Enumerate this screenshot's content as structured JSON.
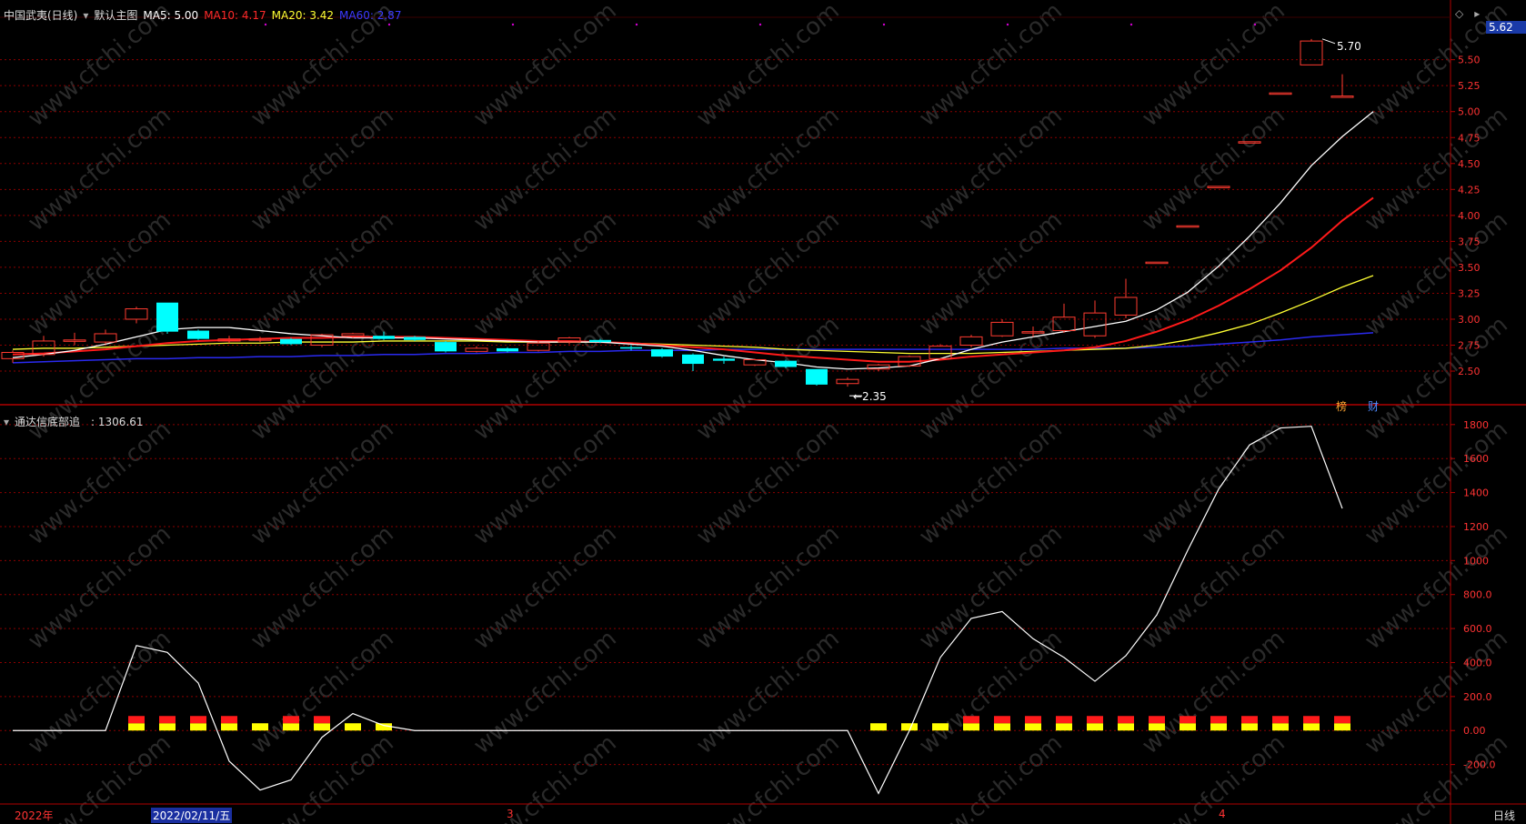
{
  "main_header": {
    "stock_name": "中国武夷(日线)",
    "template": "默认主图",
    "ma5": "MA5: 5.00",
    "ma10": "MA10: 4.17",
    "ma20": "MA20: 3.42",
    "ma60": "MA60: 2.87"
  },
  "indicator_header": {
    "name": "通达信底部追",
    "value": ": 1306.61"
  },
  "price_marks": {
    "high": "5.70",
    "low": "2.35"
  },
  "current_price": "5.62",
  "price_axis_ticks": [
    "5.50",
    "5.25",
    "5.00",
    "4.75",
    "4.50",
    "4.25",
    "4.00",
    "3.75",
    "3.50",
    "3.25",
    "3.00",
    "2.75",
    "2.50"
  ],
  "indicator_axis_ticks": [
    "1800",
    "1600",
    "1400",
    "1200",
    "1000",
    "800.0",
    "600.0",
    "400.0",
    "200.0",
    "0.00",
    "-200.0"
  ],
  "bottom_axis": {
    "year": "2022年",
    "cursor_date": "2022/02/11/五",
    "m3": "3",
    "m4": "4",
    "period": "日线"
  },
  "chart_badges": {
    "bang": "榜",
    "cai": "财"
  },
  "watermark": "www.cfchi.com",
  "colors": {
    "up": "#ff3b30",
    "down": "#00ffff",
    "ma5": "#ffffff",
    "ma10": "#ff1a1a",
    "ma20": "#ffff33",
    "ma60": "#2a2af0",
    "bg": "#000000",
    "grid": "#8b0000"
  },
  "chart_data": [
    {
      "type": "candlestick",
      "y_ticks": [
        2.5,
        2.75,
        3.0,
        3.25,
        3.5,
        3.75,
        4.0,
        4.25,
        4.5,
        4.75,
        5.0,
        5.25,
        5.5
      ],
      "ylim": [
        2.22,
        5.9
      ],
      "candles": [
        {
          "o": 2.62,
          "c": 2.68,
          "h": 2.7,
          "l": 2.58
        },
        {
          "o": 2.66,
          "c": 2.79,
          "h": 2.84,
          "l": 2.64
        },
        {
          "o": 2.79,
          "c": 2.8,
          "h": 2.87,
          "l": 2.75
        },
        {
          "o": 2.78,
          "c": 2.86,
          "h": 2.9,
          "l": 2.76
        },
        {
          "o": 3.0,
          "c": 3.1,
          "h": 3.12,
          "l": 2.96
        },
        {
          "o": 3.16,
          "c": 2.88,
          "h": 3.16,
          "l": 2.86
        },
        {
          "o": 2.89,
          "c": 2.81,
          "h": 2.9,
          "l": 2.8
        },
        {
          "o": 2.79,
          "c": 2.81,
          "h": 2.84,
          "l": 2.77
        },
        {
          "o": 2.81,
          "c": 2.81,
          "h": 2.83,
          "l": 2.78
        },
        {
          "o": 2.81,
          "c": 2.76,
          "h": 2.82,
          "l": 2.75
        },
        {
          "o": 2.75,
          "c": 2.85,
          "h": 2.86,
          "l": 2.73
        },
        {
          "o": 2.84,
          "c": 2.86,
          "h": 2.87,
          "l": 2.82
        },
        {
          "o": 2.84,
          "c": 2.81,
          "h": 2.88,
          "l": 2.8
        },
        {
          "o": 2.83,
          "c": 2.8,
          "h": 2.84,
          "l": 2.79
        },
        {
          "o": 2.78,
          "c": 2.69,
          "h": 2.79,
          "l": 2.68
        },
        {
          "o": 2.69,
          "c": 2.72,
          "h": 2.74,
          "l": 2.68
        },
        {
          "o": 2.72,
          "c": 2.69,
          "h": 2.73,
          "l": 2.68
        },
        {
          "o": 2.7,
          "c": 2.77,
          "h": 2.79,
          "l": 2.69
        },
        {
          "o": 2.78,
          "c": 2.82,
          "h": 2.83,
          "l": 2.76
        },
        {
          "o": 2.8,
          "c": 2.78,
          "h": 2.81,
          "l": 2.77
        },
        {
          "o": 2.73,
          "c": 2.72,
          "h": 2.75,
          "l": 2.7
        },
        {
          "o": 2.71,
          "c": 2.64,
          "h": 2.72,
          "l": 2.63
        },
        {
          "o": 2.66,
          "c": 2.57,
          "h": 2.67,
          "l": 2.5
        },
        {
          "o": 2.62,
          "c": 2.6,
          "h": 2.64,
          "l": 2.57
        },
        {
          "o": 2.56,
          "c": 2.61,
          "h": 2.62,
          "l": 2.55
        },
        {
          "o": 2.6,
          "c": 2.54,
          "h": 2.61,
          "l": 2.53
        },
        {
          "o": 2.52,
          "c": 2.37,
          "h": 2.52,
          "l": 2.36
        },
        {
          "o": 2.38,
          "c": 2.42,
          "h": 2.44,
          "l": 2.35
        },
        {
          "o": 2.52,
          "c": 2.56,
          "h": 2.57,
          "l": 2.5
        },
        {
          "o": 2.55,
          "c": 2.64,
          "h": 2.65,
          "l": 2.54
        },
        {
          "o": 2.62,
          "c": 2.74,
          "h": 2.76,
          "l": 2.61
        },
        {
          "o": 2.75,
          "c": 2.83,
          "h": 2.85,
          "l": 2.73
        },
        {
          "o": 2.84,
          "c": 2.97,
          "h": 3.0,
          "l": 2.83
        },
        {
          "o": 2.88,
          "c": 2.88,
          "h": 2.93,
          "l": 2.83
        },
        {
          "o": 2.89,
          "c": 3.02,
          "h": 3.15,
          "l": 2.87
        },
        {
          "o": 2.84,
          "c": 3.06,
          "h": 3.18,
          "l": 2.82
        },
        {
          "o": 3.04,
          "c": 3.21,
          "h": 3.39,
          "l": 3.01
        },
        {
          "o": 3.55,
          "c": 3.55,
          "h": 3.55,
          "l": 3.55
        },
        {
          "o": 3.9,
          "c": 3.9,
          "h": 3.9,
          "l": 3.9
        },
        {
          "o": 4.28,
          "c": 4.28,
          "h": 4.28,
          "l": 4.28
        },
        {
          "o": 4.71,
          "c": 4.71,
          "h": 4.71,
          "l": 4.71
        },
        {
          "o": 5.18,
          "c": 5.18,
          "h": 5.18,
          "l": 5.18
        },
        {
          "o": 5.45,
          "c": 5.68,
          "h": 5.7,
          "l": 5.45
        },
        {
          "o": 5.15,
          "c": 5.15,
          "h": 5.36,
          "l": 5.15
        }
      ],
      "ma5": [
        2.63,
        2.66,
        2.7,
        2.76,
        2.83,
        2.9,
        2.92,
        2.92,
        2.89,
        2.86,
        2.84,
        2.82,
        2.82,
        2.82,
        2.81,
        2.8,
        2.79,
        2.78,
        2.78,
        2.78,
        2.76,
        2.74,
        2.7,
        2.65,
        2.61,
        2.58,
        2.54,
        2.52,
        2.53,
        2.55,
        2.62,
        2.71,
        2.78,
        2.83,
        2.88,
        2.93,
        2.98,
        3.09,
        3.26,
        3.51,
        3.8,
        4.12,
        4.48,
        4.76,
        5.0
      ],
      "ma10": [
        2.66,
        2.67,
        2.69,
        2.71,
        2.74,
        2.77,
        2.79,
        2.8,
        2.81,
        2.82,
        2.82,
        2.83,
        2.83,
        2.83,
        2.82,
        2.81,
        2.8,
        2.79,
        2.79,
        2.78,
        2.77,
        2.75,
        2.73,
        2.71,
        2.68,
        2.65,
        2.63,
        2.61,
        2.59,
        2.59,
        2.61,
        2.64,
        2.66,
        2.68,
        2.7,
        2.73,
        2.79,
        2.88,
        2.99,
        3.13,
        3.29,
        3.47,
        3.69,
        3.95,
        4.17
      ],
      "ma20": [
        2.71,
        2.72,
        2.72,
        2.73,
        2.74,
        2.75,
        2.76,
        2.77,
        2.77,
        2.78,
        2.78,
        2.78,
        2.79,
        2.79,
        2.79,
        2.79,
        2.78,
        2.78,
        2.78,
        2.78,
        2.77,
        2.76,
        2.75,
        2.74,
        2.73,
        2.71,
        2.7,
        2.69,
        2.68,
        2.67,
        2.67,
        2.67,
        2.68,
        2.69,
        2.7,
        2.71,
        2.72,
        2.75,
        2.8,
        2.87,
        2.95,
        3.06,
        3.18,
        3.31,
        3.42
      ],
      "ma60": [
        2.58,
        2.59,
        2.6,
        2.61,
        2.62,
        2.62,
        2.63,
        2.63,
        2.64,
        2.64,
        2.65,
        2.65,
        2.66,
        2.66,
        2.67,
        2.67,
        2.68,
        2.68,
        2.69,
        2.69,
        2.7,
        2.7,
        2.7,
        2.71,
        2.71,
        2.71,
        2.71,
        2.71,
        2.71,
        2.71,
        2.71,
        2.71,
        2.71,
        2.71,
        2.72,
        2.72,
        2.72,
        2.73,
        2.74,
        2.76,
        2.78,
        2.8,
        2.83,
        2.85,
        2.87
      ]
    },
    {
      "type": "line",
      "name": "通达信底部追",
      "y_ticks": [
        -200,
        0,
        200,
        400,
        600,
        800,
        1000,
        1200,
        1400,
        1600,
        1800
      ],
      "ylim": [
        -400,
        1890
      ],
      "values": [
        0,
        0,
        0,
        0,
        500,
        460,
        280,
        -180,
        -350,
        -290,
        -40,
        100,
        30,
        0,
        0,
        0,
        0,
        0,
        0,
        0,
        0,
        0,
        0,
        0,
        0,
        0,
        0,
        0,
        -370,
        0,
        430,
        660,
        700,
        540,
        430,
        290,
        440,
        680,
        1060,
        1420,
        1680,
        1780,
        1790,
        1306.61
      ],
      "marker_red": [
        4,
        5,
        6,
        7,
        9,
        10,
        31,
        32,
        33,
        34,
        35,
        36,
        37,
        38,
        39,
        40,
        41,
        42,
        43
      ],
      "marker_yellow": [
        4,
        5,
        6,
        7,
        8,
        9,
        10,
        11,
        12,
        28,
        29,
        30,
        31,
        32,
        33,
        34,
        35,
        36,
        37,
        38,
        39,
        40,
        41,
        42,
        43
      ]
    }
  ]
}
